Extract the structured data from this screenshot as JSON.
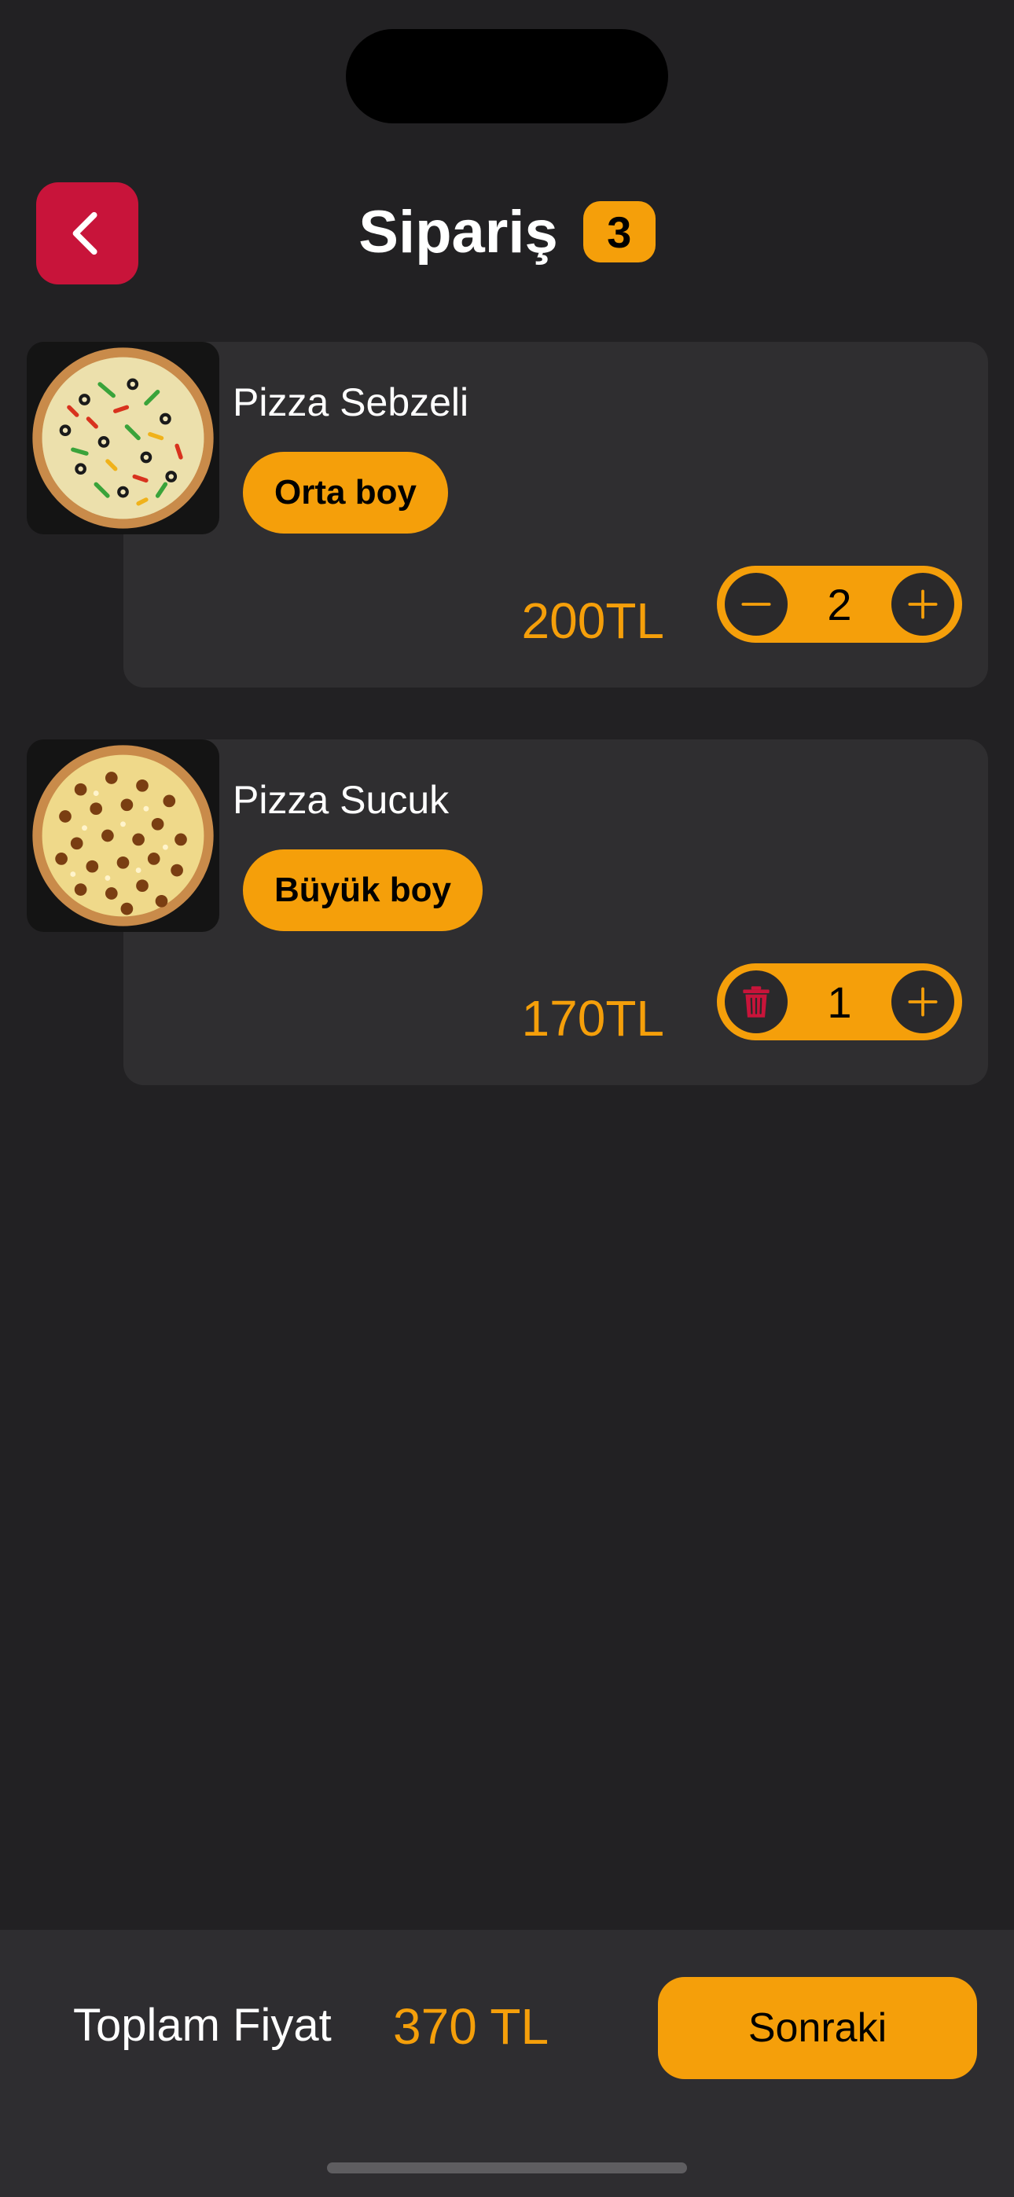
{
  "header": {
    "title": "Sipariş",
    "count": "3",
    "back_icon": "chevron-left-icon"
  },
  "colors": {
    "background": "#222123",
    "card": "#2f2e30",
    "accent": "#f59f0a",
    "back_button": "#c8143a",
    "delete_icon": "#c8143a"
  },
  "cart": {
    "items": [
      {
        "name": "Pizza Sebzeli",
        "size": "Orta boy",
        "price": "200TL",
        "quantity": "2",
        "left_action_icon": "minus-icon",
        "right_action_icon": "plus-icon",
        "image": "pizza-vegetable-image"
      },
      {
        "name": "Pizza Sucuk",
        "size": "Büyük boy",
        "price": "170TL",
        "quantity": "1",
        "left_action_icon": "trash-icon",
        "right_action_icon": "plus-icon",
        "image": "pizza-sucuk-image"
      }
    ]
  },
  "footer": {
    "total_label": "Toplam Fiyat",
    "total_value": "370 TL",
    "next_label": "Sonraki"
  }
}
